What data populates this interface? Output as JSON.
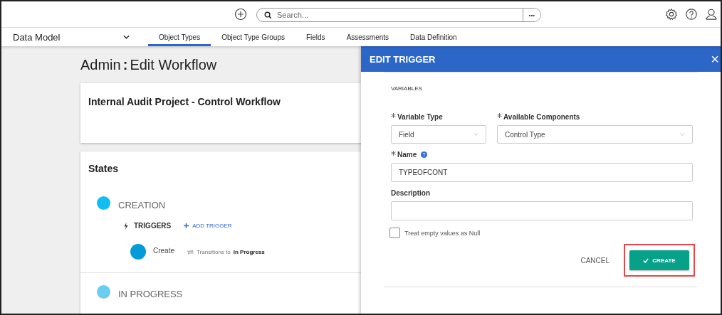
{
  "topbar": {
    "search": {
      "placeholder": "Search..."
    },
    "more_button": "•••"
  },
  "nav": {
    "app_menu": "Data Model",
    "tabs": [
      {
        "label": "Object Types",
        "selected": true
      },
      {
        "label": "Object Type Groups",
        "selected": false
      },
      {
        "label": "Fields",
        "selected": false
      },
      {
        "label": "Assessments",
        "selected": false
      },
      {
        "label": "Data Definition",
        "selected": false
      }
    ]
  },
  "page": {
    "title_prefix": "Admin",
    "title_separator": ":",
    "title": "Edit Workflow",
    "workflow_name": "Internal Audit Project - Control Workflow",
    "states_heading": "States",
    "states": [
      {
        "name": "CREATION",
        "color": "#12bdf2",
        "triggers_label": "TRIGGERS",
        "add_trigger": "ADD TRIGGER",
        "triggers": [
          {
            "name": "Create",
            "color": "#039bd8",
            "transition_label": "Transitions to",
            "target": "In Progress"
          }
        ]
      },
      {
        "name": "IN PROGRESS",
        "color": "#6ccdf0"
      }
    ]
  },
  "dialog": {
    "title": "EDIT TRIGGER",
    "close": "×",
    "section": "VARIABLES",
    "variable_type": {
      "label": "Variable Type",
      "required": true,
      "value": "Field"
    },
    "available_components": {
      "label": "Available Components",
      "required": true,
      "value": "Control Type"
    },
    "name": {
      "label": "Name",
      "required": true,
      "value": "TYPEOFCONT"
    },
    "description": {
      "label": "Description",
      "required": false
    },
    "treat_null": {
      "label": "Treat empty values as Null",
      "checked": false
    },
    "cancel": "CANCEL",
    "create": "CREATE",
    "create_highlighted": true
  }
}
